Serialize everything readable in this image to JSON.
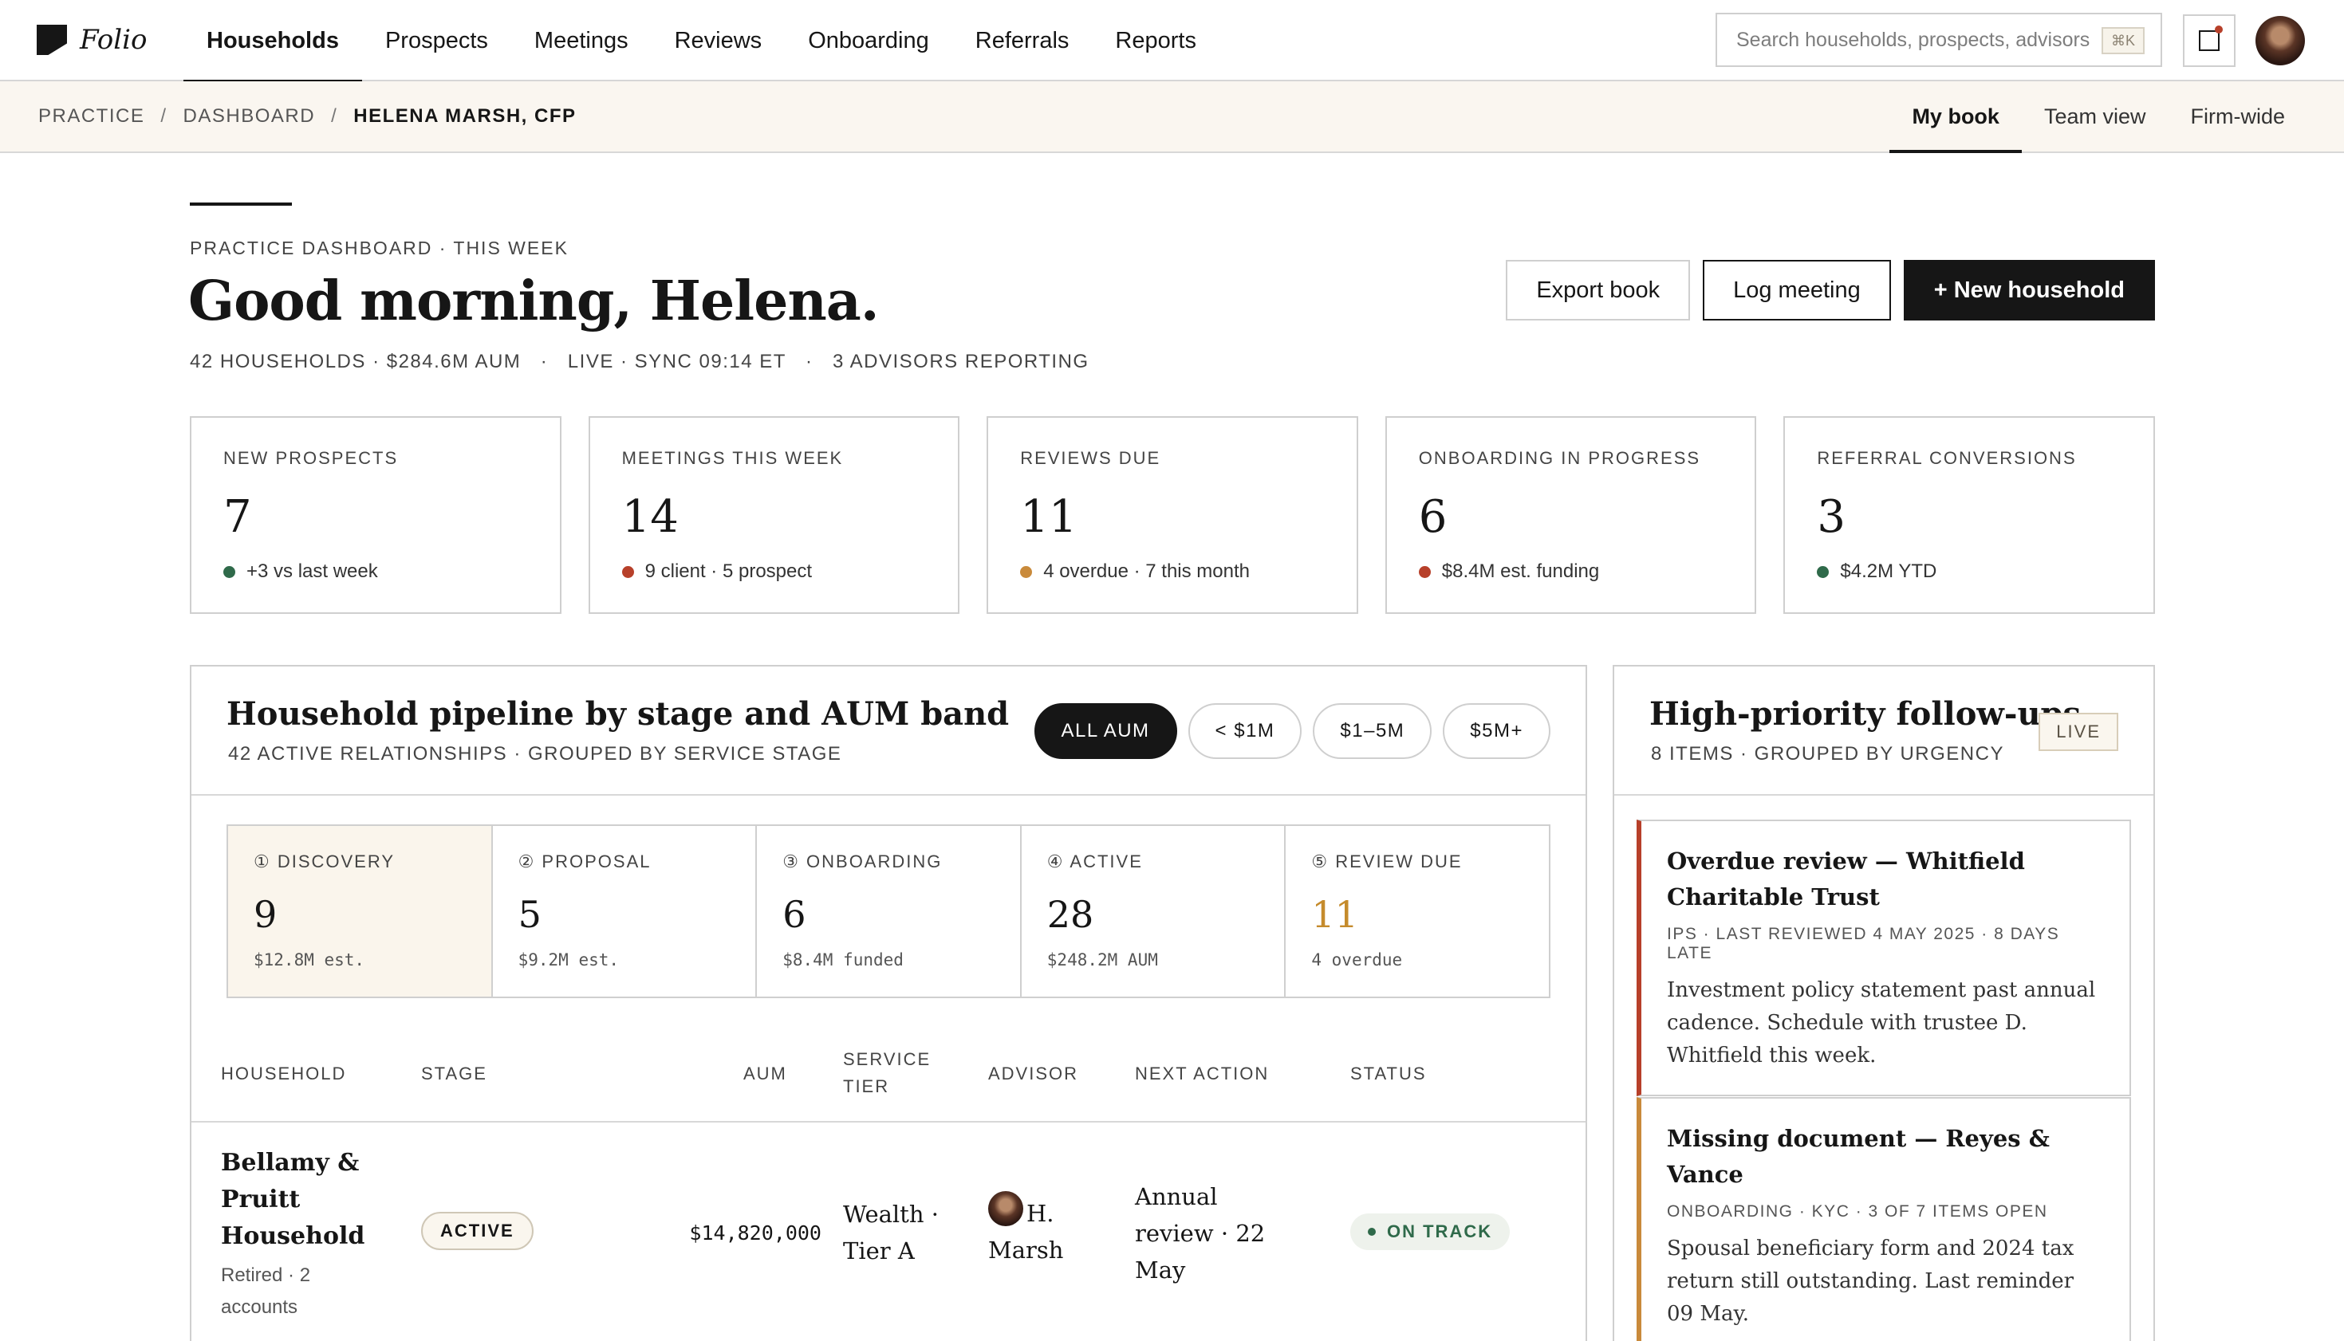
{
  "app": {
    "logo_text": "Folio"
  },
  "nav": {
    "tabs": [
      {
        "label": "Households",
        "active": true
      },
      {
        "label": "Prospects"
      },
      {
        "label": "Meetings"
      },
      {
        "label": "Reviews"
      },
      {
        "label": "Onboarding"
      },
      {
        "label": "Referrals"
      },
      {
        "label": "Reports"
      }
    ]
  },
  "search": {
    "placeholder": "Search households, prospects, advisors",
    "shortcut": "⌘K"
  },
  "breadcrumb": {
    "items": [
      "PRACTICE",
      "DASHBOARD",
      "HELENA MARSH, CFP"
    ]
  },
  "view_tabs": {
    "items": [
      "My book",
      "Team view",
      "Firm-wide"
    ],
    "active": "My book"
  },
  "header": {
    "eyebrow": "PRACTICE DASHBOARD · THIS WEEK",
    "title": "Good morning, Helena.",
    "meta": "42 HOUSEHOLDS · $284.6M AUM   ·   LIVE · SYNC 09:14 ET   ·   3 ADVISORS REPORTING",
    "actions": {
      "export": "Export book",
      "log": "Log meeting",
      "new": "+ New household"
    }
  },
  "kpis": [
    {
      "label": "New prospects",
      "value": "7",
      "sub": "+3 vs last week",
      "dot": "#2f6a4a"
    },
    {
      "label": "Meetings this week",
      "value": "14",
      "sub": "9 client · 5 prospect",
      "dot": "#b7402a"
    },
    {
      "label": "Reviews due",
      "value": "11",
      "sub": "4 overdue · 7 this month",
      "dot": "#c98a3b"
    },
    {
      "label": "Onboarding in progress",
      "value": "6",
      "sub": "$8.4M est. funding",
      "dot": "#b7402a"
    },
    {
      "label": "Referral conversions",
      "value": "3",
      "sub": "$4.2M YTD",
      "dot": "#2f6a4a"
    }
  ],
  "pipeline": {
    "title": "Household pipeline by stage and AUM band",
    "subtitle": "42 ACTIVE RELATIONSHIPS · GROUPED BY SERVICE STAGE",
    "filters": [
      "ALL AUM",
      "< $1M",
      "$1–5M",
      "$5M+"
    ],
    "active_filter": "ALL AUM",
    "stages": [
      {
        "label": "① Discovery",
        "value": "9",
        "sub": "$12.8M est."
      },
      {
        "label": "② Proposal",
        "value": "5",
        "sub": "$9.2M est."
      },
      {
        "label": "③ Onboarding",
        "value": "6",
        "sub": "$8.4M funded"
      },
      {
        "label": "④ Active",
        "value": "28",
        "sub": "$248.2M AUM"
      },
      {
        "label": "⑤ Review due",
        "value": "11",
        "sub": "4 overdue"
      }
    ],
    "columns": {
      "household": "HOUSEHOLD",
      "stage": "STAGE",
      "aum": "AUM",
      "service_tier": "SERVICE TIER",
      "advisor": "ADVISOR",
      "next_action": "NEXT ACTION",
      "status": "STATUS"
    },
    "rows": [
      {
        "household": "Bellamy & Pruitt Household",
        "household_sub": "Retired · 2 accounts",
        "stage": "ACTIVE",
        "aum": "$14,820,000",
        "service_tier": "Wealth · Tier A",
        "advisor": "H. Marsh",
        "next_action": "Annual review · 22 May",
        "status": "ON TRACK"
      }
    ]
  },
  "followups": {
    "title": "High-priority follow-ups",
    "subtitle": "8 ITEMS · GROUPED BY URGENCY",
    "badge": "LIVE",
    "items": [
      {
        "title": "Overdue review — Whitfield Charitable Trust",
        "meta": "IPS · LAST REVIEWED 4 MAY 2025 · 8 DAYS LATE",
        "body": "Investment policy statement past annual cadence. Schedule with trustee D. Whitfield this week.",
        "accent": "#b7402a"
      },
      {
        "title": "Missing document — Reyes & Vance",
        "meta": "ONBOARDING · KYC · 3 OF 7 ITEMS OPEN",
        "body": "Spousal beneficiary form and 2024 tax return still outstanding. Last reminder 09 May.",
        "accent": "#c98a3b"
      }
    ]
  }
}
